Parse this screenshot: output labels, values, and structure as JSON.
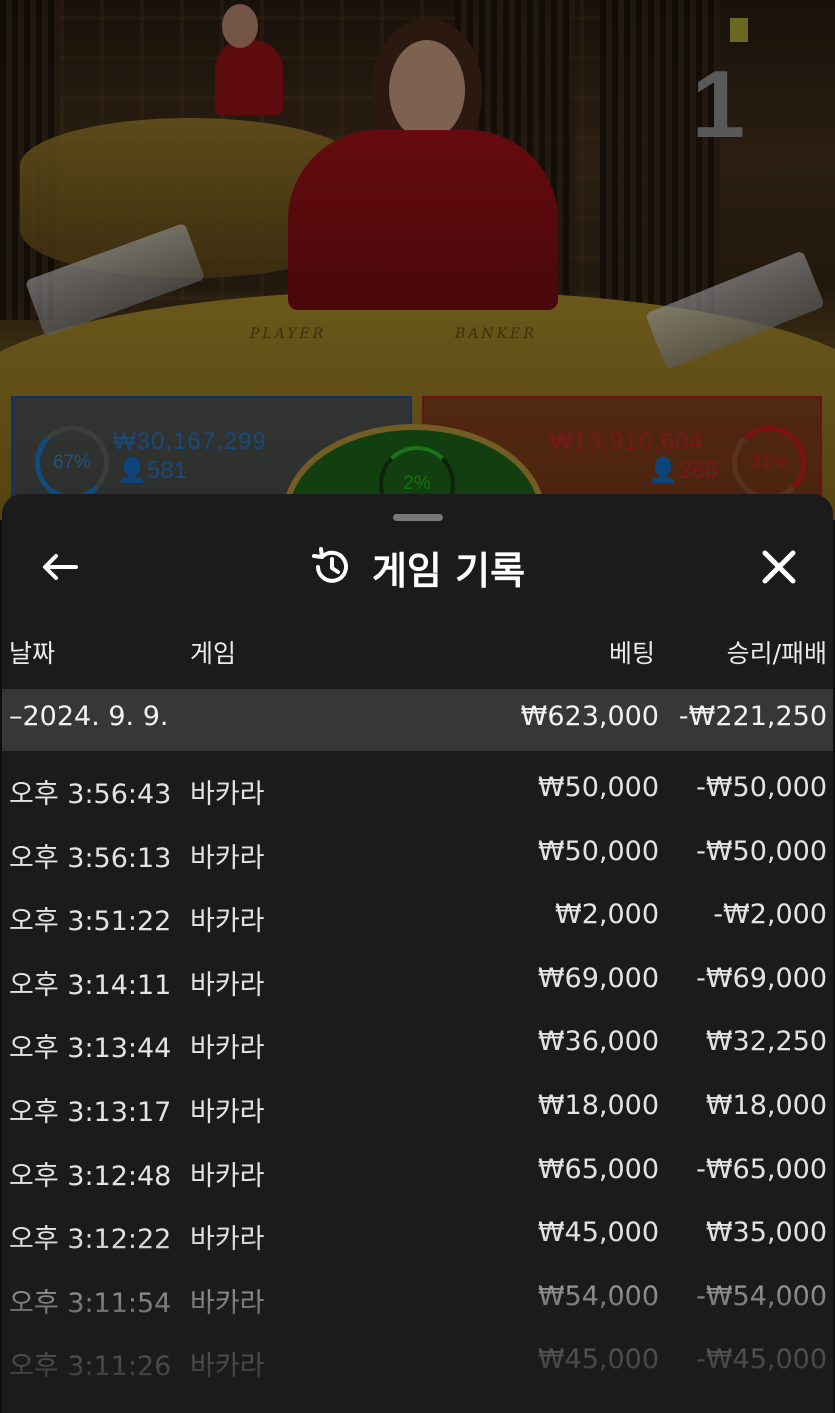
{
  "stream": {
    "round_number": "1",
    "table_labels": {
      "player": "PLAYER",
      "banker": "BANKER"
    },
    "player": {
      "percent": "67%",
      "amount": "₩30,167,299",
      "count": "581",
      "color": "#2080d8"
    },
    "banker": {
      "percent": "31%",
      "amount": "₩13,910,604",
      "count": "286",
      "color": "#d82020"
    },
    "tie": {
      "percent": "2%",
      "color": "#22c322"
    }
  },
  "history": {
    "title": "게임 기록",
    "icons": {
      "back": "arrow-left-icon",
      "title": "history-icon",
      "close": "close-icon"
    },
    "columns": {
      "date": "날짜",
      "game": "게임",
      "bet": "베팅",
      "result": "승리/패배"
    },
    "summary": {
      "date": "–2024. 9. 9.",
      "bet": "₩623,000",
      "result": "-₩221,250"
    },
    "rows": [
      {
        "time": "오후 3:56:43",
        "game": "바카라",
        "bet": "₩50,000",
        "result": "-₩50,000"
      },
      {
        "time": "오후 3:56:13",
        "game": "바카라",
        "bet": "₩50,000",
        "result": "-₩50,000"
      },
      {
        "time": "오후 3:51:22",
        "game": "바카라",
        "bet": "₩2,000",
        "result": "-₩2,000"
      },
      {
        "time": "오후 3:14:11",
        "game": "바카라",
        "bet": "₩69,000",
        "result": "-₩69,000"
      },
      {
        "time": "오후 3:13:44",
        "game": "바카라",
        "bet": "₩36,000",
        "result": "₩32,250"
      },
      {
        "time": "오후 3:13:17",
        "game": "바카라",
        "bet": "₩18,000",
        "result": "₩18,000"
      },
      {
        "time": "오후 3:12:48",
        "game": "바카라",
        "bet": "₩65,000",
        "result": "-₩65,000"
      },
      {
        "time": "오후 3:12:22",
        "game": "바카라",
        "bet": "₩45,000",
        "result": "₩35,000"
      },
      {
        "time": "오후 3:11:54",
        "game": "바카라",
        "bet": "₩54,000",
        "result": "-₩54,000"
      },
      {
        "time": "오후 3:11:26",
        "game": "바카라",
        "bet": "₩45,000",
        "result": "-₩45,000"
      }
    ]
  }
}
